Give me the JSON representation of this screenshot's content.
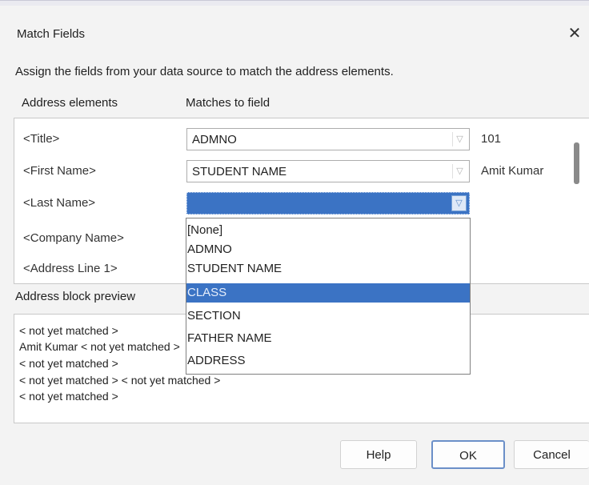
{
  "dialog": {
    "title": "Match Fields",
    "close_glyph": "✕",
    "instruction": "Assign the fields from your data source to match the address elements."
  },
  "columns": {
    "address_elements": "Address elements",
    "matches_to_field": "Matches to field"
  },
  "fields": [
    {
      "label": "<Title>",
      "match": "ADMNO",
      "sample": "101"
    },
    {
      "label": "<First Name>",
      "match": "STUDENT NAME",
      "sample": "Amit Kumar"
    },
    {
      "label": "<Last Name>",
      "match": "",
      "sample": ""
    },
    {
      "label": "<Company Name>",
      "match": "",
      "sample": ""
    },
    {
      "label": "<Address Line 1>",
      "match": "",
      "sample": ""
    }
  ],
  "dropdown": {
    "options": [
      "[None]",
      "ADMNO",
      "STUDENT NAME",
      "CLASS",
      "SECTION",
      "FATHER NAME",
      "ADDRESS"
    ],
    "highlighted": "CLASS"
  },
  "preview": {
    "label": "Address block preview",
    "lines": [
      "< not yet matched >",
      "Amit Kumar < not yet matched >",
      "< not yet matched >",
      "< not yet matched > < not yet matched >",
      "< not yet matched >"
    ]
  },
  "buttons": {
    "help": "Help",
    "ok": "OK",
    "cancel": "Cancel"
  },
  "icons": {
    "close": "close-icon",
    "combo_arrow": "chevron-down-icon"
  },
  "colors": {
    "selection": "#3b73c4",
    "ok_border": "#6b8fc8"
  }
}
